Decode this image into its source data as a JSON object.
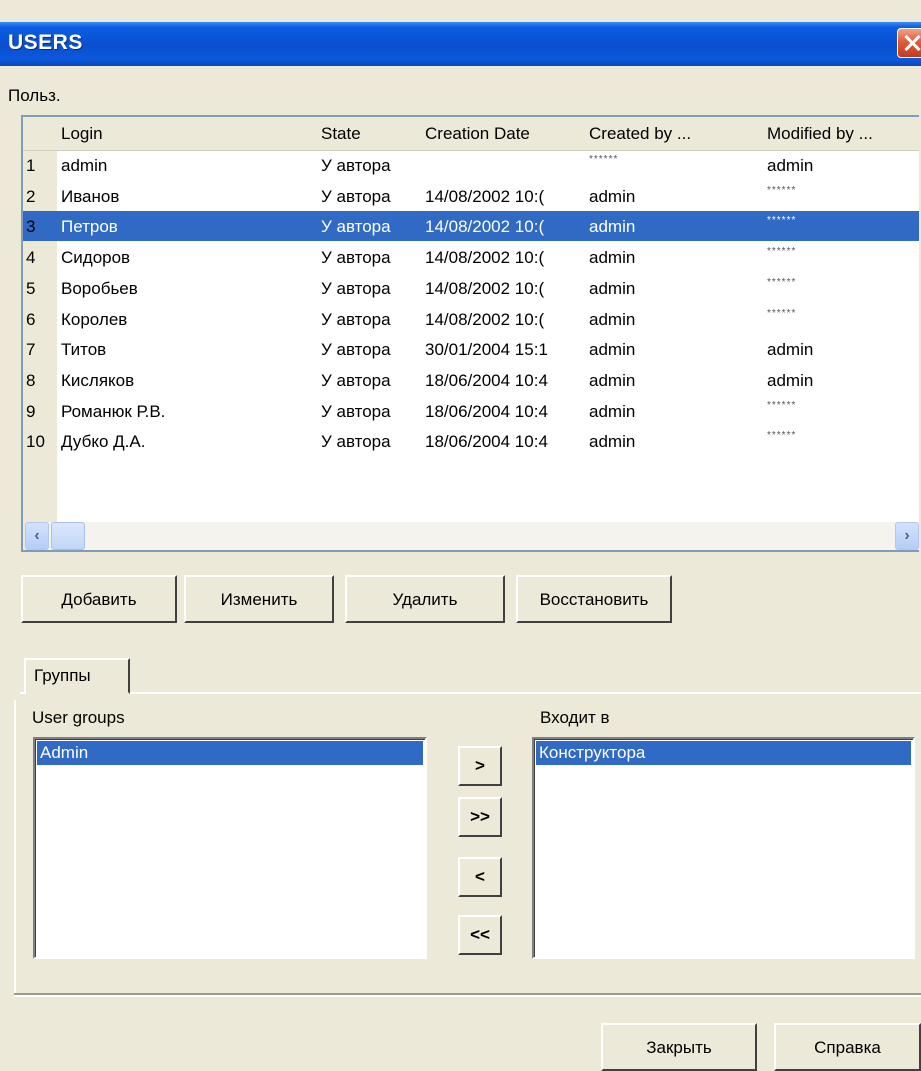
{
  "window": {
    "title": "USERS"
  },
  "users_section": {
    "label": "Польз."
  },
  "grid": {
    "columns": [
      "Login",
      "State",
      "Creation Date",
      "Created by ...",
      "Modified by ..."
    ],
    "rows": [
      {
        "n": "1",
        "login": "admin",
        "state": "У автора",
        "date": "",
        "created_by": "******",
        "modified_by": "admin"
      },
      {
        "n": "2",
        "login": "Иванов",
        "state": "У автора",
        "date": "14/08/2002 10:(",
        "created_by": "admin",
        "modified_by": "******"
      },
      {
        "n": "3",
        "login": "Петров",
        "state": "У автора",
        "date": "14/08/2002 10:(",
        "created_by": "admin",
        "modified_by": "******"
      },
      {
        "n": "4",
        "login": "Сидоров",
        "state": "У автора",
        "date": "14/08/2002 10:(",
        "created_by": "admin",
        "modified_by": "******"
      },
      {
        "n": "5",
        "login": "Воробьев",
        "state": "У автора",
        "date": "14/08/2002 10:(",
        "created_by": "admin",
        "modified_by": "******"
      },
      {
        "n": "6",
        "login": "Королев",
        "state": "У автора",
        "date": "14/08/2002 10:(",
        "created_by": "admin",
        "modified_by": "******"
      },
      {
        "n": "7",
        "login": "Титов",
        "state": "У автора",
        "date": "30/01/2004 15:1",
        "created_by": "admin",
        "modified_by": "admin"
      },
      {
        "n": "8",
        "login": "Кисляков",
        "state": "У автора",
        "date": "18/06/2004 10:4",
        "created_by": "admin",
        "modified_by": "admin"
      },
      {
        "n": "9",
        "login": "Романюк Р.В.",
        "state": "У автора",
        "date": "18/06/2004 10:4",
        "created_by": "admin",
        "modified_by": "******"
      },
      {
        "n": "10",
        "login": "Дубко Д.А.",
        "state": "У автора",
        "date": "18/06/2004 10:4",
        "created_by": "admin",
        "modified_by": "******"
      }
    ],
    "selected_row": 2
  },
  "actions": {
    "add": "Добавить",
    "edit": "Изменить",
    "delete": "Удалить",
    "restore": "Восстановить"
  },
  "tabs": {
    "groups": "Группы"
  },
  "groups": {
    "user_groups_label": "User groups",
    "user_groups_items": [
      "Admin"
    ],
    "member_of_label": "Входит в",
    "member_of_items": [
      "Конструктора"
    ],
    "move_right": ">",
    "move_all_right": ">>",
    "move_left": "<",
    "move_all_left": "<<"
  },
  "footer": {
    "close": "Закрыть",
    "help": "Справка"
  },
  "icons": {
    "close": "close-icon",
    "scroll_left": "arrow-left-icon",
    "scroll_right": "arrow-right-icon"
  },
  "colors": {
    "titlebar": "#0a4fd0",
    "selection": "#316ac5",
    "window_bg": "#ece9d8"
  }
}
